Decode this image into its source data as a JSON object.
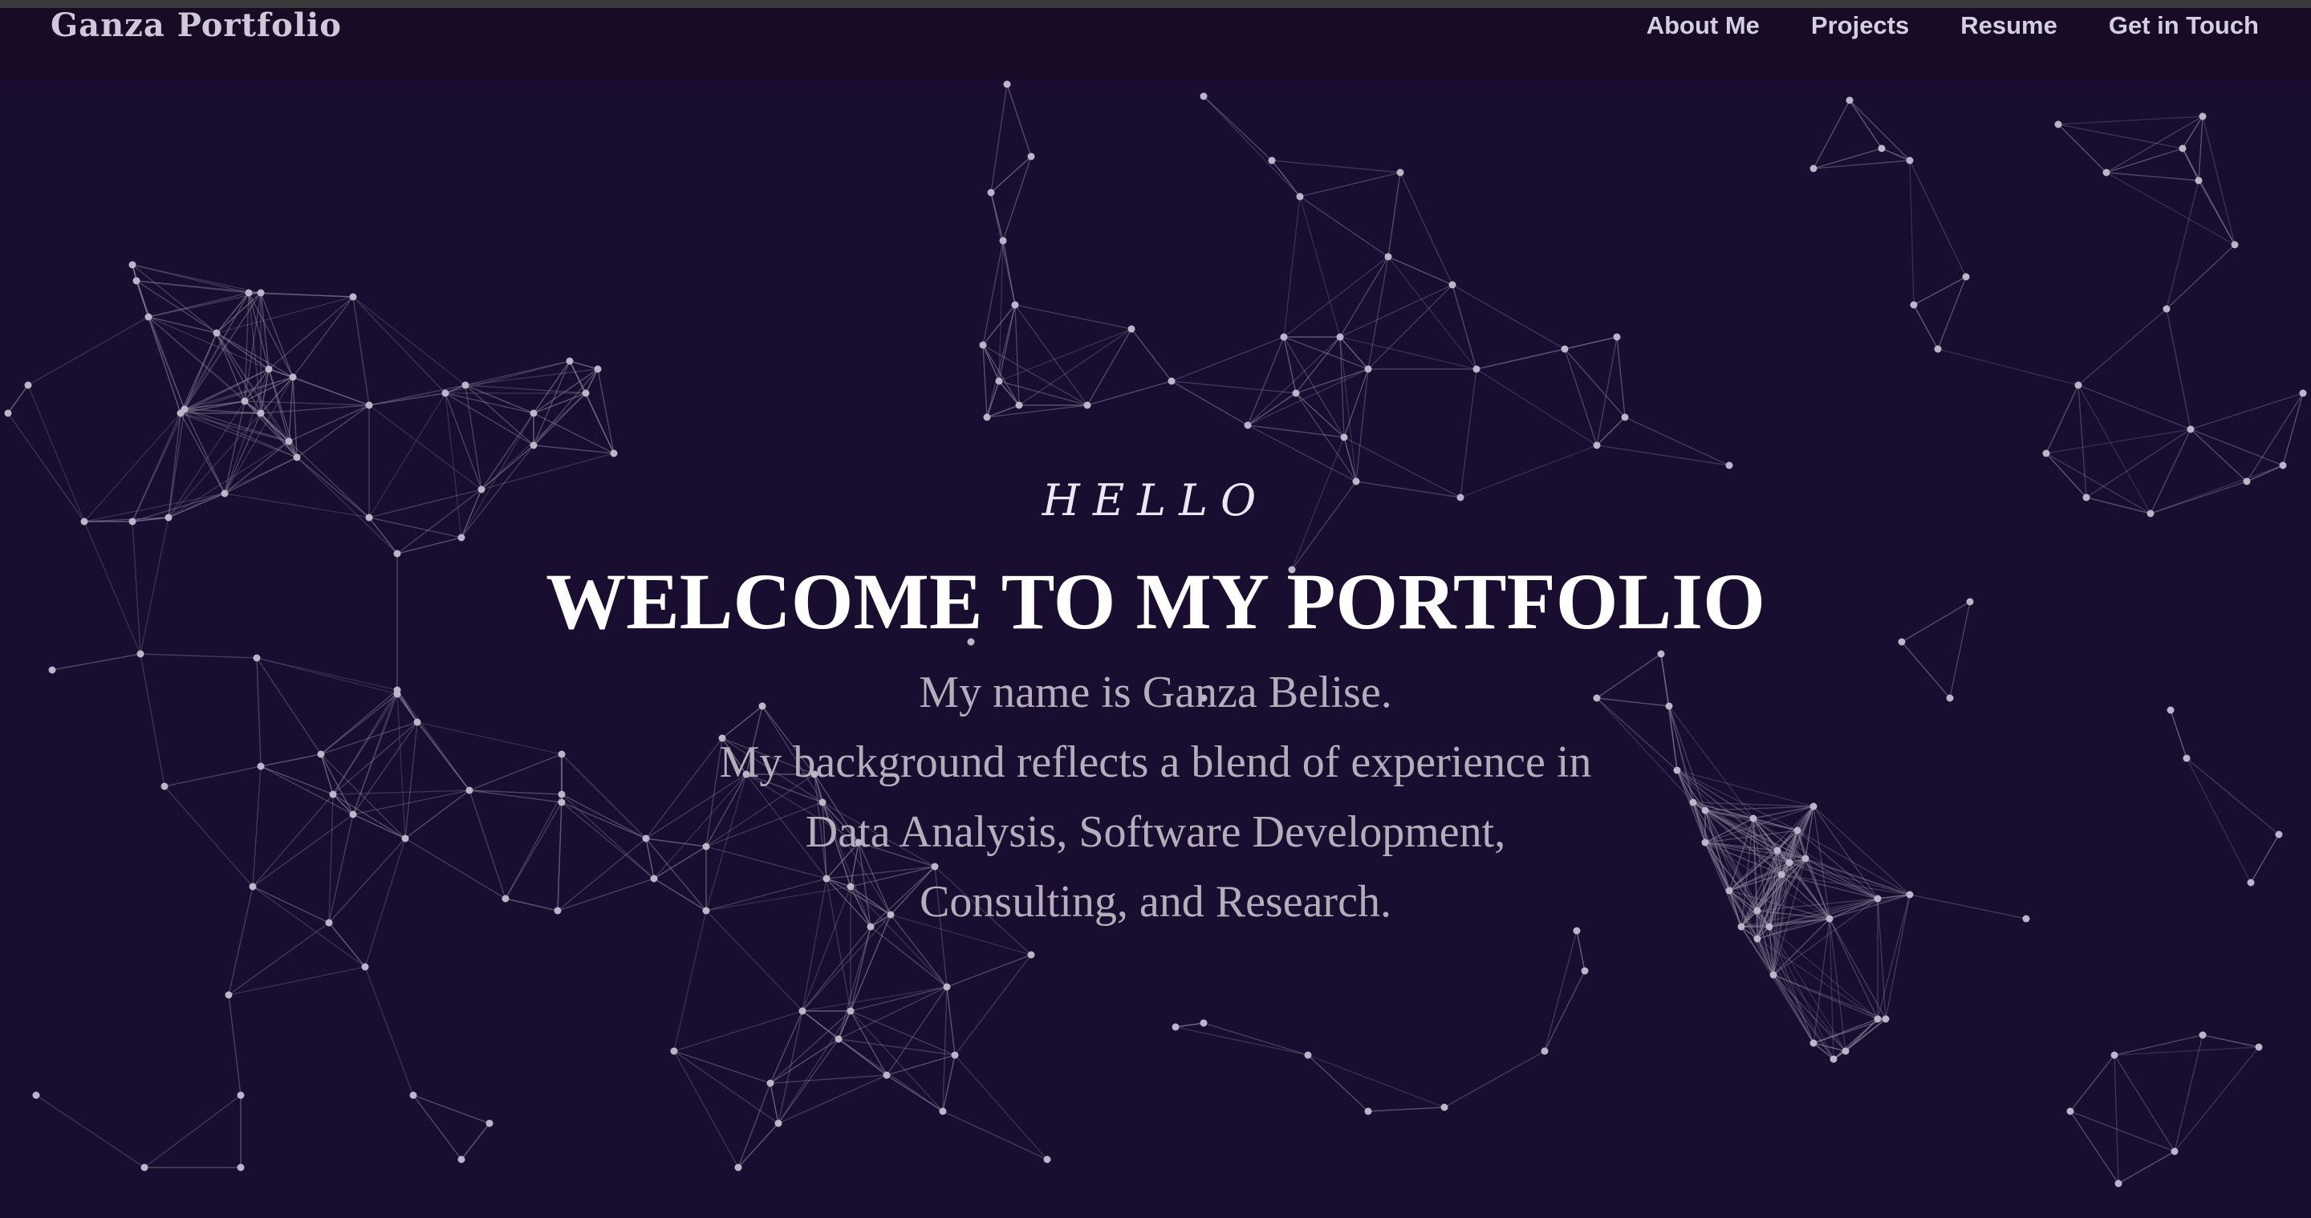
{
  "brand": {
    "name": "Ganza Portfolio"
  },
  "nav": {
    "items": [
      {
        "label": "About Me"
      },
      {
        "label": "Projects"
      },
      {
        "label": "Resume"
      },
      {
        "label": "Get in Touch"
      }
    ]
  },
  "hero": {
    "greeting": "HELLO",
    "title": "WELCOME TO MY PORTFOLIO",
    "intro_lines": [
      "My name is Ganza Belise.",
      "My background reflects a blend of experience in",
      "Data Analysis, Software Development,",
      "Consulting, and Research."
    ]
  },
  "colors": {
    "background": "#1a0e30",
    "navbar": "#170b26",
    "node": "#bdb6c8",
    "link": "#8a839a"
  }
}
